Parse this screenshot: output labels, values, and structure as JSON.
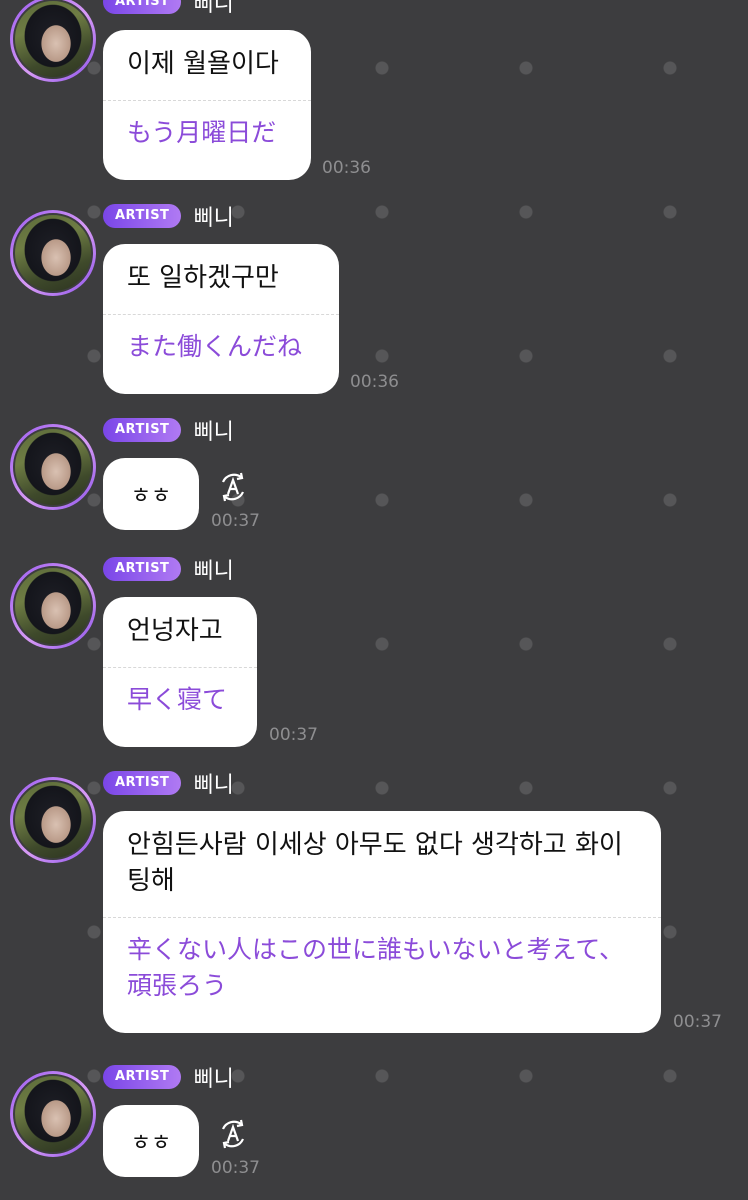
{
  "chat": {
    "messages": [
      {
        "badge": "ARTIST",
        "sender": "삐니",
        "original": "이제 월욜이다",
        "translation": "もう月曜日だ",
        "time": "00:36"
      },
      {
        "badge": "ARTIST",
        "sender": "삐니",
        "original": "또 일하겠구만",
        "translation": "また働くんだね",
        "time": "00:36"
      },
      {
        "badge": "ARTIST",
        "sender": "삐니",
        "original": "ㅎㅎ",
        "time": "00:37",
        "translate_icon": "translate-a-icon"
      },
      {
        "badge": "ARTIST",
        "sender": "삐니",
        "original": "언넝자고",
        "translation": "早く寝て",
        "time": "00:37"
      },
      {
        "badge": "ARTIST",
        "sender": "삐니",
        "original": "안힘든사람 이세상 아무도 없다 생각하고 화이팅해",
        "translation": "辛くない人はこの世に誰もいないと考えて、頑張ろう",
        "time": "00:37"
      },
      {
        "badge": "ARTIST",
        "sender": "삐니",
        "original": "ㅎㅎ",
        "time": "00:37",
        "translate_icon": "translate-a-icon"
      }
    ]
  },
  "colors": {
    "background": "#3d3d3f",
    "badge_gradient_start": "#7a46e8",
    "badge_gradient_end": "#b07af3",
    "translation_text": "#8b4bd9",
    "timestamp": "#8e8e90"
  }
}
